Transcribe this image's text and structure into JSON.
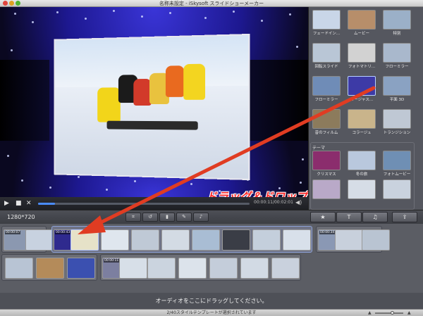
{
  "window": {
    "title": "名称未設定 - iSkysoft スライドショーメーカー"
  },
  "preview": {
    "timecode": "00:00:11/00:02:01",
    "progress": 0.08,
    "annotation": "ドラッグ＆ドロップ"
  },
  "transport": {
    "play_icon": "play-icon",
    "stop_icon": "stop-icon",
    "close_icon": "close-icon",
    "volume_icon": "speaker-icon"
  },
  "templates": {
    "items": [
      {
        "label": "フェードイン...",
        "color": "#c9d6e8"
      },
      {
        "label": "ムービー",
        "color": "#b78e6a"
      },
      {
        "label": "特別",
        "color": "#9bb0c8"
      },
      {
        "label": "回転スライド",
        "color": "#b9c6d6"
      },
      {
        "label": "フォトマトリ...",
        "color": "#d2d2d2"
      },
      {
        "label": "フローミラー",
        "color": "#a9b8cc"
      },
      {
        "label": "フローミラー",
        "color": "#6f8cb7"
      },
      {
        "label": "ミージャス...",
        "color": "#3d3aa6"
      },
      {
        "label": "平面 3D",
        "color": "#8aa2c2"
      },
      {
        "label": "昔のフィルム",
        "color": "#8c7b5c"
      },
      {
        "label": "コラージュ",
        "color": "#c9b48b"
      },
      {
        "label": "トランジション",
        "color": "#bfc8d4"
      }
    ],
    "theme_header": "テーマ",
    "themes": [
      {
        "label": "クリスマス",
        "color": "#8b2d6d"
      },
      {
        "label": "冬の旅",
        "color": "#b9c8dd"
      },
      {
        "label": "フォトムービー",
        "color": "#6f8fb4"
      },
      {
        "label": "",
        "color": "#b9a9c8"
      },
      {
        "label": "",
        "color": "#d6dde6"
      },
      {
        "label": "",
        "color": "#c9d2de"
      }
    ]
  },
  "toolbar": {
    "resolution": "1280*720",
    "tools": [
      "crop-icon",
      "rotate-left-icon",
      "delete-icon",
      "edit-icon",
      "mic-icon"
    ],
    "tabs": [
      "star-icon",
      "text-icon",
      "music-icon",
      "export-icon"
    ]
  },
  "timeline": {
    "timecodes": [
      "00:00:07",
      "00:00:43",
      "00:00:34",
      "00:00:11"
    ],
    "audio_hint": "オーディオをここにドラッグしてください。"
  },
  "status": {
    "text": "2/40スタイルテンプレートが選択されています"
  },
  "colors": {
    "arrow": "#e03c22",
    "annotation": "#ff2b2b",
    "accent": "#4a8cff"
  }
}
